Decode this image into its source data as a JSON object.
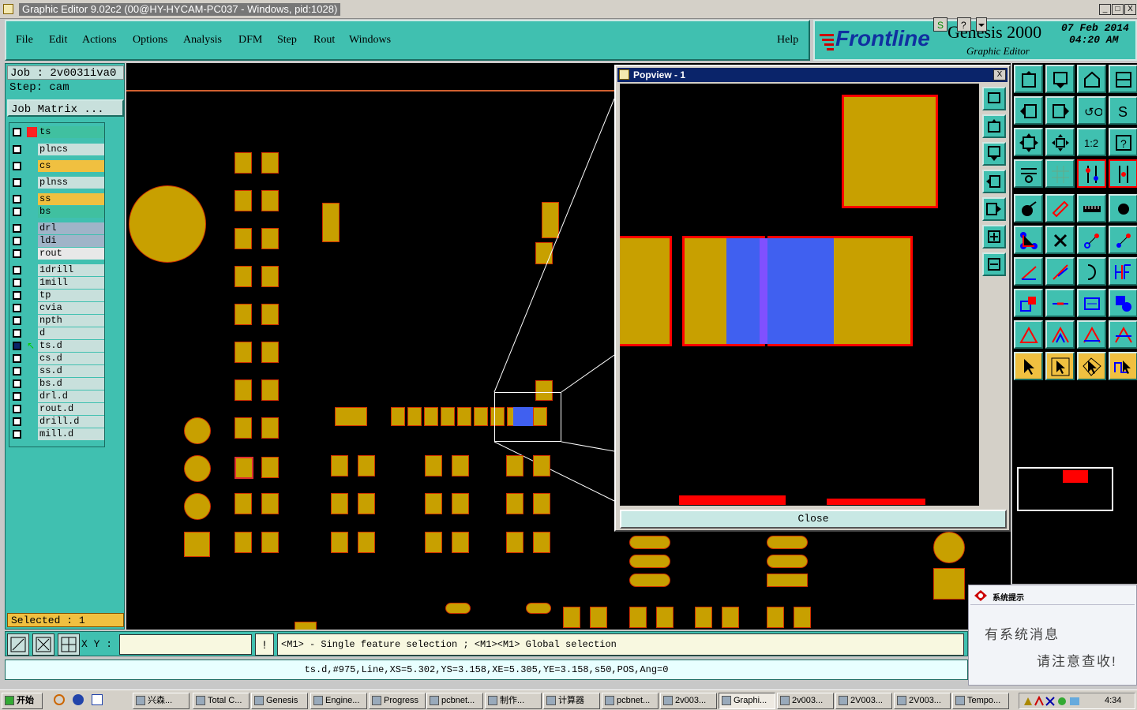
{
  "window": {
    "title": "Graphic Editor 9.02c2 (00@HY-HYCAM-PC037 - Windows, pid:1028)",
    "minimize": "_",
    "maximize": "□",
    "close": "X"
  },
  "menu": {
    "items": [
      "File",
      "Edit",
      "Actions",
      "Options",
      "Analysis",
      "DFM",
      "Step",
      "Rout",
      "Windows"
    ],
    "help": "Help"
  },
  "brand": {
    "logo": "Frontline",
    "product": "Genesis 2000",
    "subtitle": "Graphic Editor",
    "date": "07 Feb 2014",
    "time": "04:20 AM"
  },
  "job": {
    "job_line": "Job : 2v0031iva0",
    "step_line": "Step: cam",
    "matrix_button": "Job Matrix ..."
  },
  "layers": [
    {
      "name": "ts",
      "color": "#40c0a0",
      "flag": true
    },
    {
      "name": "plncs",
      "color": "#c8e0dc"
    },
    {
      "name": "cs",
      "color": "#f0c040"
    },
    {
      "name": "plnss",
      "color": "#c8e0dc"
    },
    {
      "name": "ss",
      "color": "#f0c040"
    },
    {
      "name": "bs",
      "color": "#40c0a0"
    },
    {
      "name": "drl",
      "color": "#a0b4c8"
    },
    {
      "name": "ldi",
      "color": "#a0b4c8"
    },
    {
      "name": "rout",
      "color": "#e8e8e8"
    },
    {
      "name": "1drill",
      "color": "#c8e0dc"
    },
    {
      "name": "1mill",
      "color": "#c8e0dc"
    },
    {
      "name": "tp",
      "color": "#c8e0dc"
    },
    {
      "name": "cvia",
      "color": "#c8e0dc"
    },
    {
      "name": "npth",
      "color": "#c8e0dc"
    },
    {
      "name": "d",
      "color": "#c8e0dc"
    },
    {
      "name": "ts.d",
      "color": "#c8e0dc",
      "active": true
    },
    {
      "name": "cs.d",
      "color": "#c8e0dc"
    },
    {
      "name": "ss.d",
      "color": "#c8e0dc"
    },
    {
      "name": "bs.d",
      "color": "#c8e0dc"
    },
    {
      "name": "drl.d",
      "color": "#c8e0dc"
    },
    {
      "name": "rout.d",
      "color": "#c8e0dc"
    },
    {
      "name": "drill.d",
      "color": "#c8e0dc"
    },
    {
      "name": "mill.d",
      "color": "#c8e0dc"
    }
  ],
  "selected": "Selected : 1",
  "popview": {
    "title": "Popview - 1",
    "close_label": "Close",
    "close_x": "X"
  },
  "command": {
    "xy_label": "X Y :",
    "xy_value": "",
    "hint": "<M1> - Single feature selection ; <M1><M1> Global selection",
    "status": "ts.d,#975,Line,XS=5.302,YS=3.158,XE=5.305,YE=3.158,s50,POS,Ang=0"
  },
  "notice": {
    "title": "系统提示",
    "line1": "有系统消息",
    "line2": "请注意查收!"
  },
  "taskbar": {
    "start": "开始",
    "clock": "4:34",
    "tasks": [
      "兴森...",
      "Total C...",
      "Genesis",
      "Engine...",
      "Progress",
      "pcbnet...",
      "制作...",
      "计算器",
      "pcbnet...",
      "2v003...",
      "Graphi...",
      "2v003...",
      "2V003...",
      "2V003...",
      "Tempo..."
    ]
  },
  "colors": {
    "panel": "#40c0b0",
    "pad_fill": "#c8a000",
    "pad_edge": "#d03000",
    "highlight": "#4060f0",
    "select_red": "#ff0000"
  }
}
